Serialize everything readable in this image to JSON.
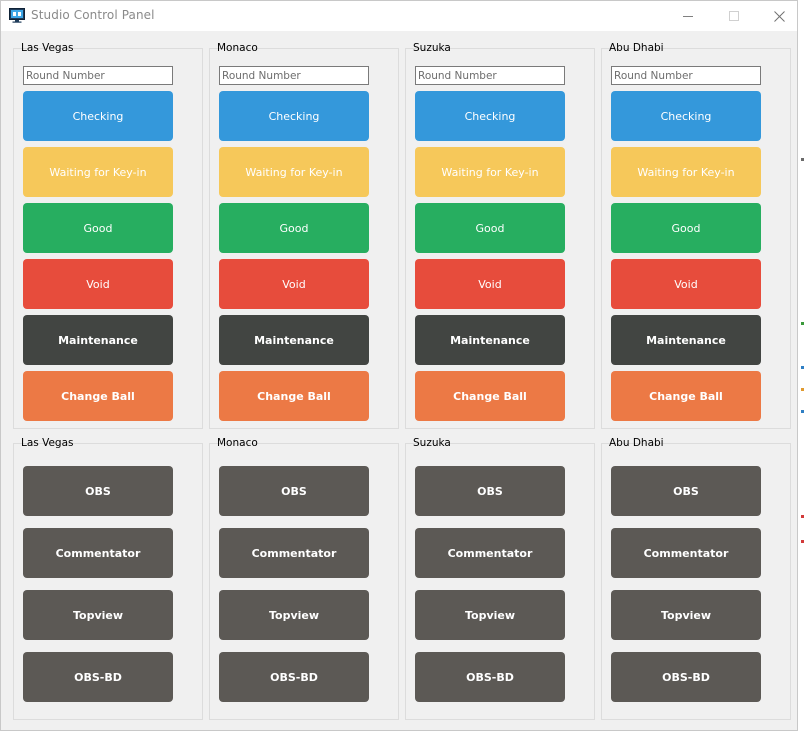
{
  "window": {
    "title": "Studio Control Panel",
    "minimize_icon": "minimize-icon",
    "maximize_icon": "maximize-icon",
    "close_icon": "close-icon"
  },
  "tables": [
    "Las Vegas",
    "Monaco",
    "Suzuka",
    "Abu Dhabi"
  ],
  "round_placeholder": "Round Number",
  "status_buttons": [
    {
      "label": "Checking",
      "color": "#3498db",
      "bold": false
    },
    {
      "label": "Waiting for Key-in",
      "color": "#f6c85a",
      "bold": false
    },
    {
      "label": "Good",
      "color": "#27ae60",
      "bold": false
    },
    {
      "label": "Void",
      "color": "#e74c3c",
      "bold": false
    },
    {
      "label": "Maintenance",
      "color": "#424542",
      "bold": true
    },
    {
      "label": "Change Ball",
      "color": "#ec7945",
      "bold": true
    }
  ],
  "camera_buttons": [
    {
      "label": "OBS",
      "color": "#5c5955"
    },
    {
      "label": "Commentator",
      "color": "#5c5955"
    },
    {
      "label": "Topview",
      "color": "#5c5955"
    },
    {
      "label": "OBS-BD",
      "color": "#5c5955"
    }
  ]
}
